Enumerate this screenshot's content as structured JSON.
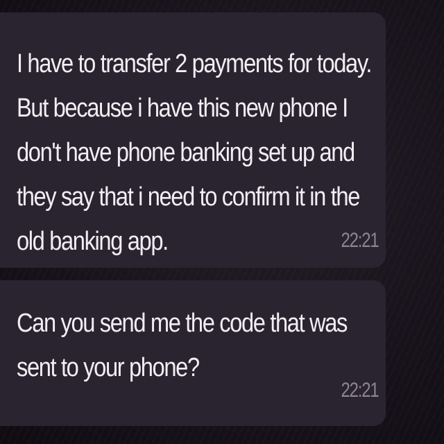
{
  "messages": [
    {
      "text": "I have to transfer 2 payments for today. But because i have this new phone I don't have phone banking set up and they say that i need to confirm it in the old banking app.",
      "time": "22:21"
    },
    {
      "text": "Can you send me the code that was sent to your phone?",
      "time": "22:21"
    }
  ],
  "colors": {
    "background": "#141016",
    "bubble": "#2a2430",
    "text": "#f2eef4",
    "timestamp": "#8d8692"
  }
}
